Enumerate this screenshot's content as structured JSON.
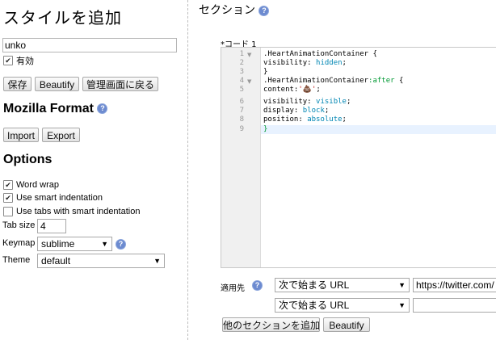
{
  "left": {
    "title": "スタイルを追加",
    "name_value": "unko",
    "enabled_label": "有効",
    "buttons": {
      "save": "保存",
      "beautify": "Beautify",
      "back": "管理画面に戻る"
    },
    "mozilla_title": "Mozilla Format",
    "import_label": "Import",
    "export_label": "Export",
    "options_title": "Options",
    "word_wrap": "Word wrap",
    "smart_indent": "Use smart indentation",
    "tabs_smart": "Use tabs with smart indentation",
    "tab_size_label": "Tab size",
    "tab_size_value": "4",
    "keymap_label": "Keymap",
    "keymap_value": "sublime",
    "theme_label": "Theme",
    "theme_value": "default",
    "check_mark": "✔"
  },
  "section": {
    "title": "セクション",
    "code_label": "*コード 1",
    "line_numbers": [
      "1",
      "2",
      "3",
      "4",
      "5",
      "6",
      "7",
      "8",
      "9"
    ],
    "code": {
      "l1": ".HeartAnimationContainer {",
      "l2a": "visibility: ",
      "l2b": "hidden",
      "l2c": ";",
      "l3": "}",
      "l4a": ".HeartAnimationContainer",
      "l4b": ":after",
      "l4c": " {",
      "l5a": "content:",
      "l5b": "'💩'",
      "l5c": ";",
      "l6a": "visibility: ",
      "l6b": "visible",
      "l6c": ";",
      "l7a": "display: ",
      "l7b": "block",
      "l7c": ";",
      "l8a": "position: ",
      "l8b": "absolute",
      "l8c": ";",
      "l9": "}"
    },
    "applies_label": "適用先",
    "rule1_type": "次で始まる URL",
    "rule1_value": "https://twitter.com/",
    "rule2_type": "次で始まる URL",
    "rule2_value": "",
    "add_section": "他のセクションを追加",
    "beautify": "Beautify"
  },
  "icons": {
    "help": "?",
    "fold": "▼",
    "dropdown": "▼"
  },
  "colors": {
    "help_icon": "#6d8bd0",
    "active_line": "#e8f2ff",
    "keyword": "#0086b3",
    "string": "#c41a16"
  }
}
